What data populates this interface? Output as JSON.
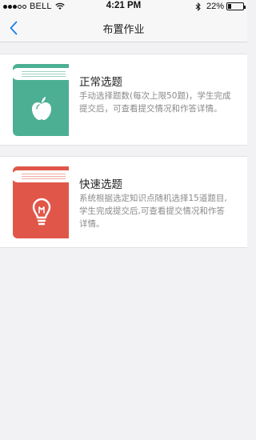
{
  "status_bar": {
    "carrier": "BELL",
    "time": "4:21 PM",
    "battery_percent": "22%",
    "battery_level": 0.22,
    "signal_strength": 3,
    "icons": [
      "wifi-icon",
      "bluetooth-icon",
      "battery-icon"
    ]
  },
  "nav": {
    "title": "布置作业",
    "back_icon": "chevron-left-icon"
  },
  "colors": {
    "accent_blue": "#1a7de6",
    "book_green": "#4caf93",
    "book_red": "#e0574a",
    "background": "#f2f2f4"
  },
  "options": [
    {
      "title": "正常选题",
      "description": "手动选择题数(每次上限50题)，学生完成提交后，可查看提交情况和作答详情。",
      "icon": "apple-icon",
      "color": "#4caf93"
    },
    {
      "title": "快速选题",
      "description": "系统根据选定知识点随机选择15道题目,学生完成提交后,可查看提交情况和作答详情。",
      "icon": "lightbulb-icon",
      "color": "#e0574a"
    }
  ]
}
